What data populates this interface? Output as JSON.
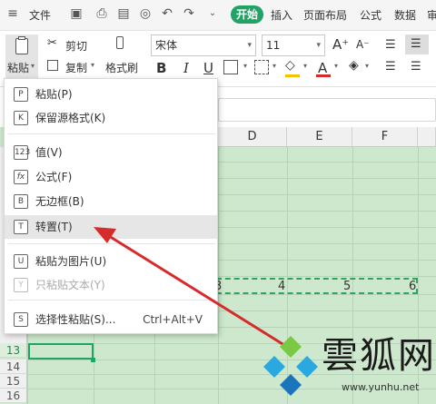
{
  "menubar": {
    "file": "文件",
    "tabs": [
      "开始",
      "插入",
      "页面布局",
      "公式",
      "数据",
      "审"
    ]
  },
  "ribbon": {
    "paste": "粘贴",
    "cut": "剪切",
    "copy": "复制",
    "format_painter": "格式刷",
    "font_name": "宋体",
    "font_size": "11",
    "bold": "B",
    "italic": "I",
    "underline": "U",
    "font_color": "A"
  },
  "columns": [
    "D",
    "E",
    "F"
  ],
  "rows": [
    "13",
    "14",
    "15",
    "16"
  ],
  "cells": [
    "3",
    "4",
    "5",
    "6"
  ],
  "paste_menu": {
    "items": [
      {
        "label": "粘贴(P)",
        "icon": "paste-icon",
        "glyph": "P"
      },
      {
        "label": "保留源格式(K)",
        "icon": "keep-source-format-icon",
        "glyph": "K"
      },
      {
        "label": "值(V)",
        "icon": "paste-values-icon",
        "glyph": "123"
      },
      {
        "label": "公式(F)",
        "icon": "paste-formula-icon",
        "glyph": "fx"
      },
      {
        "label": "无边框(B)",
        "icon": "no-border-icon",
        "glyph": "B"
      },
      {
        "label": "转置(T)",
        "icon": "transpose-icon",
        "glyph": "T"
      },
      {
        "label": "粘贴为图片(U)",
        "icon": "paste-as-picture-icon",
        "glyph": "U"
      },
      {
        "label": "只粘贴文本(Y)",
        "icon": "paste-text-only-icon",
        "glyph": "Y"
      },
      {
        "label": "选择性粘贴(S)...",
        "icon": "paste-special-icon",
        "glyph": "S",
        "shortcut": "Ctrl+Alt+V"
      }
    ]
  },
  "watermark": {
    "text": "雲狐网",
    "url": "www.yunhu.net"
  },
  "colors": {
    "accent": "#21a366",
    "grid": "#cde8cd",
    "arrow": "#d62b2b"
  }
}
